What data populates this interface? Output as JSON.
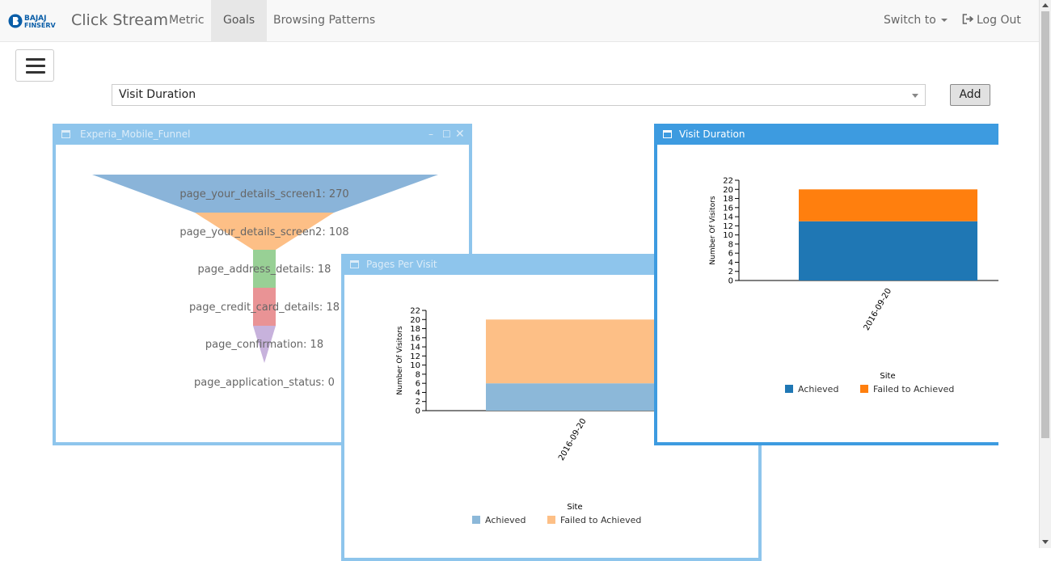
{
  "brand": {
    "logo_text_1": "BAJAJ",
    "logo_text_2": "FINSERV",
    "app_title": "Click Stream"
  },
  "nav": {
    "items": [
      {
        "label": "Metric"
      },
      {
        "label": "Goals"
      },
      {
        "label": "Browsing Patterns"
      }
    ],
    "switch_label": "Switch to",
    "logout_label": "Log Out"
  },
  "toolbar": {
    "selected_goal": "Visit Duration",
    "add_label": "Add"
  },
  "funnel_window": {
    "title": "Experia_Mobile_Funnel",
    "stages": [
      {
        "label": "page_your_details_screen1: 270",
        "color": "#8ab4d9"
      },
      {
        "label": "page_your_details_screen2: 108",
        "color": "#fdbf86"
      },
      {
        "label": "page_address_details: 18",
        "color": "#98d095"
      },
      {
        "label": "page_credit_card_details: 18",
        "color": "#e99395"
      },
      {
        "label": "page_confirmation: 18",
        "color": "#c7b2dc"
      },
      {
        "label": "page_application_status: 0",
        "color": "#cccccc"
      }
    ]
  },
  "pages_window": {
    "title": "Pages Per Visit",
    "xlabel": "Site",
    "ylabel": "Number Of Visitors",
    "category": "2016-09-20",
    "legend": [
      "Achieved",
      "Failed to Achieved"
    ]
  },
  "duration_window": {
    "title": "Visit Duration",
    "xlabel": "Site",
    "ylabel": "Number Of Visitors",
    "category": "2016-09-20",
    "legend": [
      "Achieved",
      "Failed to Achieved"
    ]
  },
  "chart_data": [
    {
      "type": "funnel",
      "title": "Experia_Mobile_Funnel",
      "categories": [
        "page_your_details_screen1",
        "page_your_details_screen2",
        "page_address_details",
        "page_credit_card_details",
        "page_confirmation",
        "page_application_status"
      ],
      "values": [
        270,
        108,
        18,
        18,
        18,
        0
      ]
    },
    {
      "type": "bar",
      "title": "Pages Per Visit",
      "categories": [
        "2016-09-20"
      ],
      "series": [
        {
          "name": "Achieved",
          "values": [
            6
          ],
          "color": "#8cb8d9"
        },
        {
          "name": "Failed to Achieved",
          "values": [
            14
          ],
          "color": "#fdbf86"
        }
      ],
      "stacked": true,
      "xlabel": "Site",
      "ylabel": "Number Of Visitors",
      "ylim": [
        0,
        22
      ],
      "yticks": [
        0,
        2,
        4,
        6,
        8,
        10,
        12,
        14,
        16,
        18,
        20,
        22
      ]
    },
    {
      "type": "bar",
      "title": "Visit Duration",
      "categories": [
        "2016-09-20"
      ],
      "series": [
        {
          "name": "Achieved",
          "values": [
            13
          ],
          "color": "#1f77b4"
        },
        {
          "name": "Failed to Achieved",
          "values": [
            7
          ],
          "color": "#ff7f0e"
        }
      ],
      "stacked": true,
      "xlabel": "Site",
      "ylabel": "Number Of Visitors",
      "ylim": [
        0,
        22
      ],
      "yticks": [
        0,
        2,
        4,
        6,
        8,
        10,
        12,
        14,
        16,
        18,
        20,
        22
      ]
    }
  ]
}
